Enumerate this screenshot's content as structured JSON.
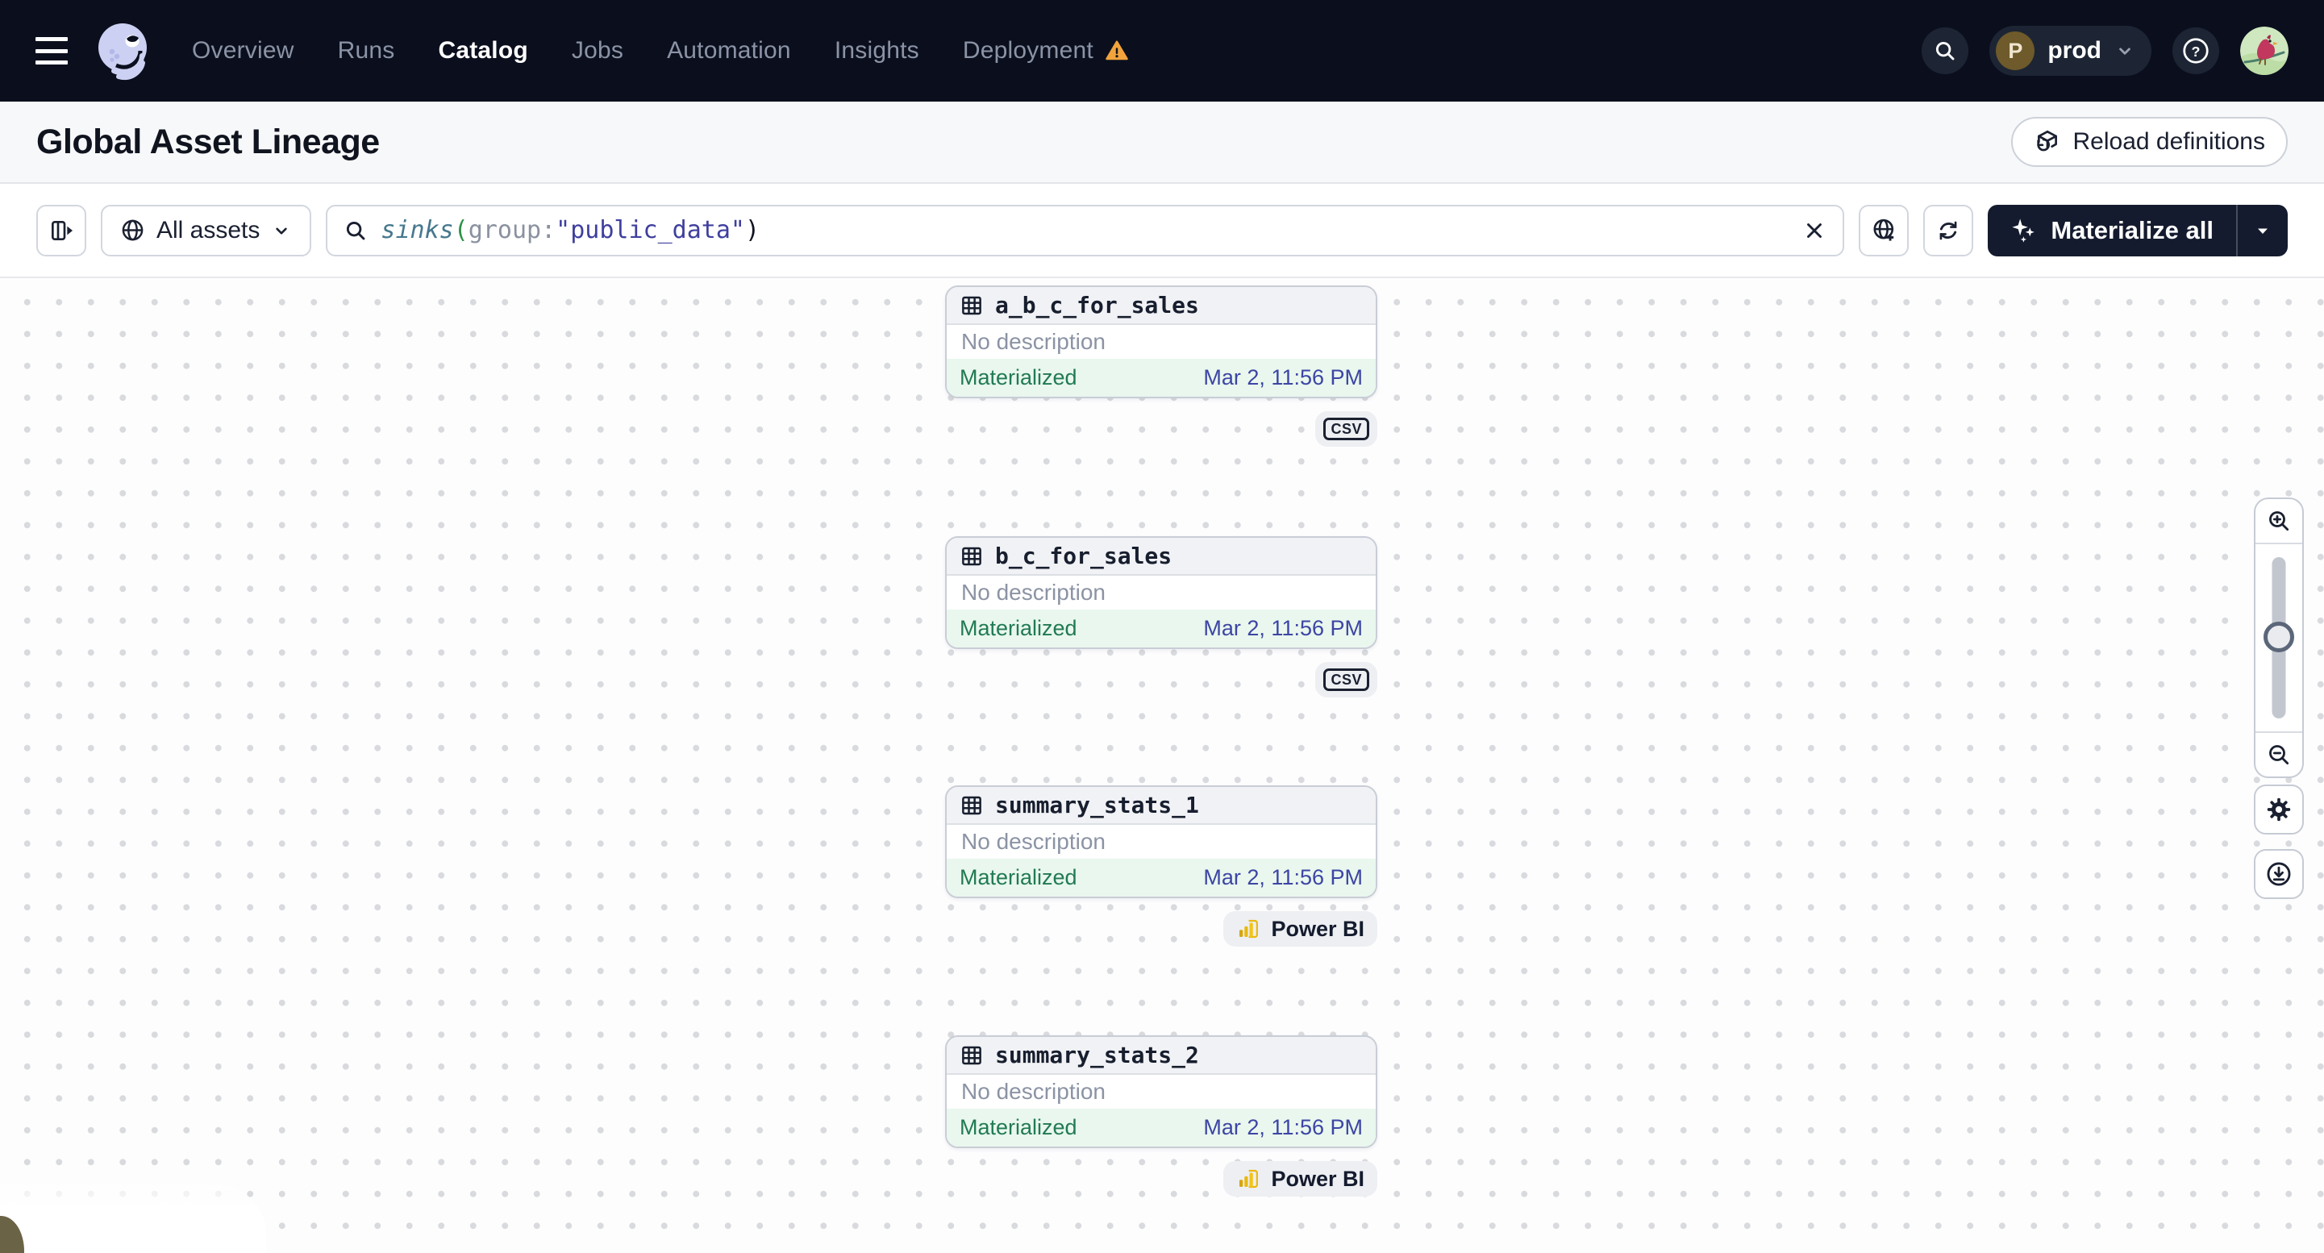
{
  "colors": {
    "nav_bg": "#0b0f1d",
    "accent_dark": "#141b2e",
    "status_green": "#217a52",
    "status_green_bg": "#e9f7ee",
    "timestamp_indigo": "#3d45a4",
    "warning_orange": "#f2a33c",
    "powerbi_yellow": "#e9b80f"
  },
  "nav": {
    "items": [
      {
        "label": "Overview",
        "active": false
      },
      {
        "label": "Runs",
        "active": false
      },
      {
        "label": "Catalog",
        "active": true
      },
      {
        "label": "Jobs",
        "active": false
      },
      {
        "label": "Automation",
        "active": false
      },
      {
        "label": "Insights",
        "active": false
      },
      {
        "label": "Deployment",
        "active": false,
        "warning": true
      }
    ],
    "environment": {
      "initial": "P",
      "label": "prod"
    }
  },
  "header": {
    "title": "Global Asset Lineage",
    "reload_button_label": "Reload definitions"
  },
  "toolbar": {
    "scope_selector_label": "All assets",
    "search": {
      "tokens": [
        {
          "text": "sinks",
          "kind": "function"
        },
        {
          "text": "(",
          "kind": "paren"
        },
        {
          "text": "group",
          "kind": "attribute"
        },
        {
          "text": ":",
          "kind": "colon"
        },
        {
          "text": "\"public_data\"",
          "kind": "value"
        },
        {
          "text": ")",
          "kind": "paren-close"
        }
      ]
    },
    "materialize_button_label": "Materialize all"
  },
  "graph": {
    "assets": [
      {
        "name": "a_b_c_for_sales",
        "description": "No description",
        "status": "Materialized",
        "timestamp": "Mar 2, 11:56 PM",
        "kind": "csv",
        "kind_label": "CSV"
      },
      {
        "name": "b_c_for_sales",
        "description": "No description",
        "status": "Materialized",
        "timestamp": "Mar 2, 11:56 PM",
        "kind": "csv",
        "kind_label": "CSV"
      },
      {
        "name": "summary_stats_1",
        "description": "No description",
        "status": "Materialized",
        "timestamp": "Mar 2, 11:56 PM",
        "kind": "powerbi",
        "kind_label": "Power BI"
      },
      {
        "name": "summary_stats_2",
        "description": "No description",
        "status": "Materialized",
        "timestamp": "Mar 2, 11:56 PM",
        "kind": "powerbi",
        "kind_label": "Power BI"
      }
    ]
  }
}
